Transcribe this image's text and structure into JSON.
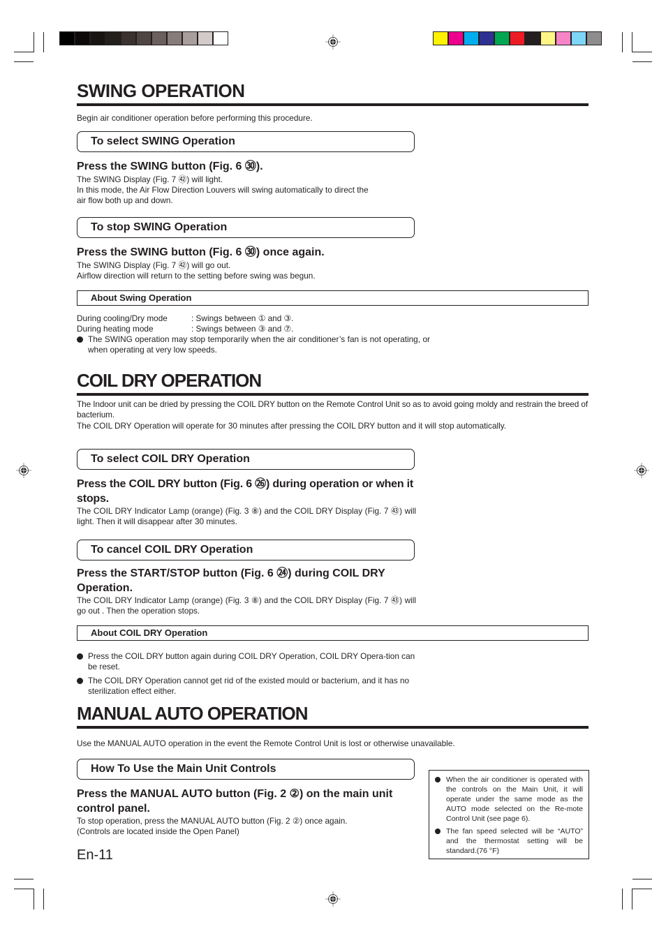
{
  "color_bars": {
    "grayscale": [
      "#000000",
      "#0c0a09",
      "#171413",
      "#231f1d",
      "#3b3230",
      "#4f4644",
      "#6b605d",
      "#877c79",
      "#a89f9d",
      "#d3cbca",
      "#ffffff"
    ],
    "process": [
      "#fff200",
      "#ec008c",
      "#00aeef",
      "#2e3192",
      "#00a651",
      "#ed1c24",
      "#231f20",
      "#fff685",
      "#f784c7",
      "#7dd6f7",
      "#8e8c8c"
    ]
  },
  "swing": {
    "title": "SWING OPERATION",
    "intro": "Begin air conditioner operation before performing this procedure.",
    "select_box": "To select SWING Operation",
    "select_step": "Press the SWING button (Fig. 6 ㉚).",
    "select_text_1": "The SWING Display (Fig. 7 ㊷) will light.",
    "select_text_2": "In this mode, the Air Flow Direction Louvers will swing automatically to direct the",
    "select_text_3": "air flow both up and down.",
    "stop_box": "To stop SWING Operation",
    "stop_step": "Press the SWING button (Fig. 6 ㉚) once again.",
    "stop_text_1": "The SWING Display (Fig. 7 ㊷) will go out.",
    "stop_text_2": "Airflow direction will return to the setting before swing was begun.",
    "about_box": "About Swing Operation",
    "modes": [
      {
        "mode": "During cooling/Dry mode",
        "value": ":  Swings between ① and ③."
      },
      {
        "mode": "During heating mode",
        "value": ":  Swings between ③ and ⑦."
      }
    ],
    "bullet": "The SWING operation may stop temporarily when the air conditioner’s fan is not operating, or when operating at very low speeds."
  },
  "coil_dry": {
    "title": "COIL DRY OPERATION",
    "intro_1": "The Indoor unit can be dried by pressing the COIL DRY button on the Remote Control Unit so as to avoid going moldy and restrain the breed of bacterium.",
    "intro_2": "The COIL DRY Operation will operate for 30 minutes after pressing the COIL DRY button and it will stop automatically.",
    "select_box": "To select COIL DRY Operation",
    "select_step": "Press the COIL DRY button (Fig. 6 ㉖) during operation or when it stops.",
    "select_text": "The COIL DRY Indicator Lamp (orange) (Fig. 3 ⑧) and the COIL DRY Display (Fig. 7 ㊸) will light. Then it will disappear after 30 minutes.",
    "cancel_box": "To cancel COIL DRY Operation",
    "cancel_step": "Press the START/STOP button (Fig. 6 ㉔) during COIL DRY Operation.",
    "cancel_text": "The COIL DRY Indicator Lamp (orange) (Fig. 3 ⑧) and the COIL DRY Display (Fig. 7 ㊸) will go out . Then the operation stops.",
    "about_box": "About COIL DRY Operation",
    "bullets": [
      "Press the COIL DRY button again during COIL DRY Operation, COIL DRY Opera-tion can be reset.",
      "The COIL DRY Operation cannot get rid of the existed mould or bacterium, and it has no sterilization effect either."
    ]
  },
  "manual_auto": {
    "title": "MANUAL AUTO OPERATION",
    "intro": "Use the MANUAL AUTO operation in the event the Remote Control Unit is lost or otherwise unavailable.",
    "howto_box": "How To Use the Main Unit Controls",
    "step": "Press the MANUAL AUTO button  (Fig. 2 ②) on the main unit control panel.",
    "text_1": "To stop operation, press the MANUAL AUTO button (Fig. 2 ②) once again.",
    "text_2": "(Controls are located inside the Open Panel)",
    "notes": [
      "When the air conditioner is operated with the controls on the Main Unit, it will operate under the same mode as the AUTO mode selected on the Re-mote Control Unit (see page 6).",
      "The fan speed selected will be “AUTO” and the thermostat setting will be standard.(76 °F)"
    ]
  },
  "page_number": "En-11"
}
